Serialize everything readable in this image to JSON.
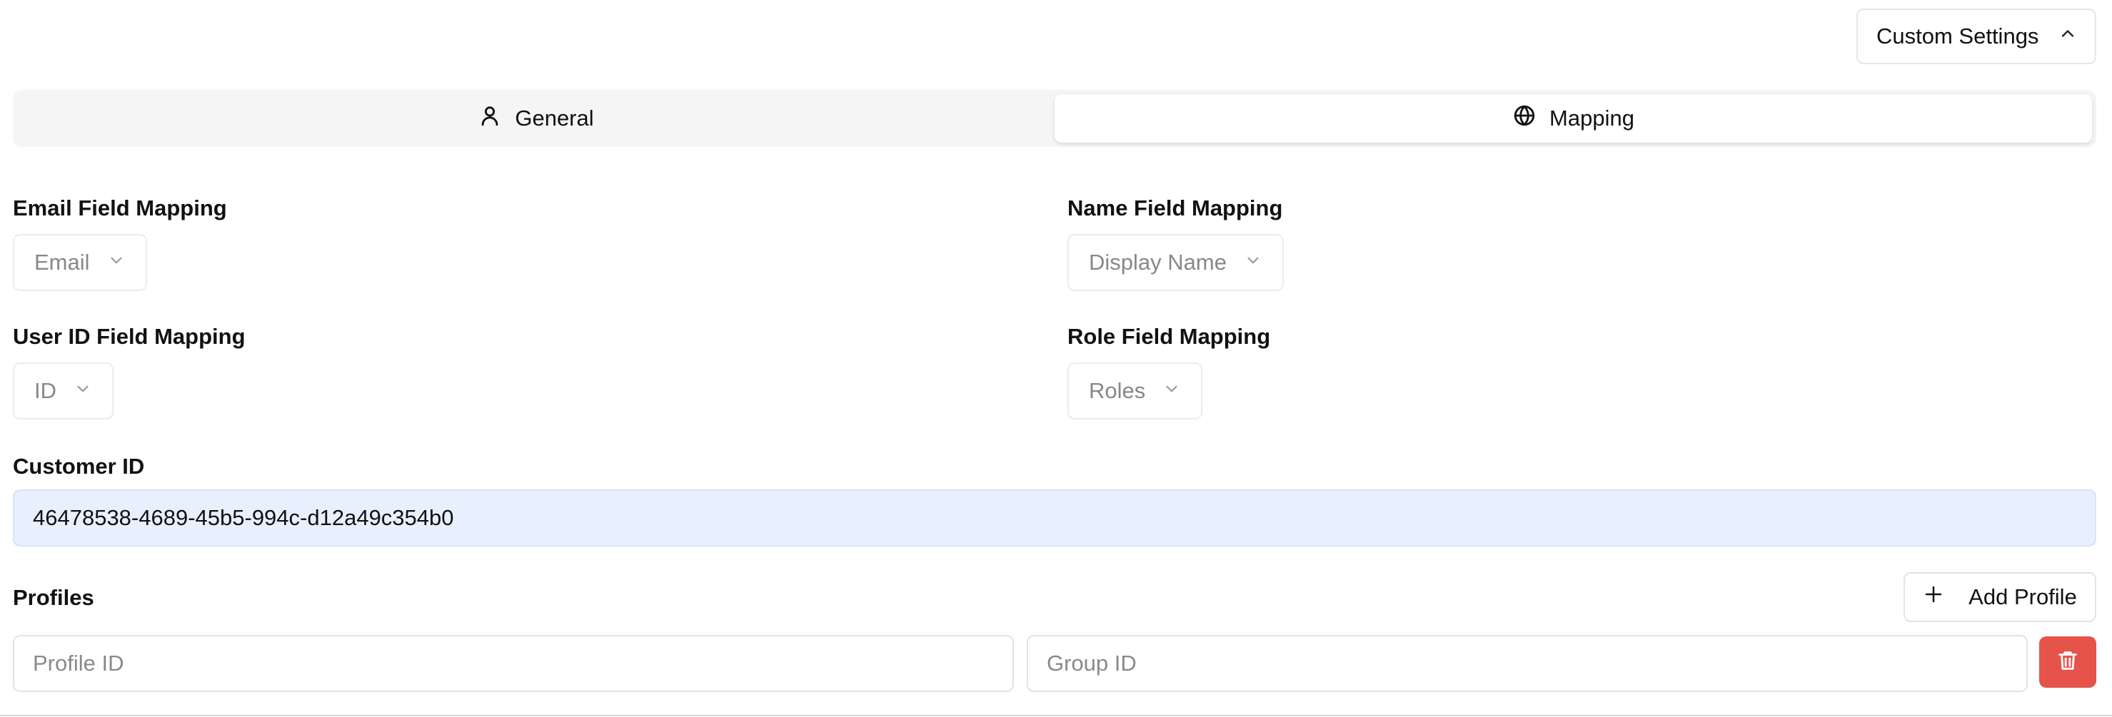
{
  "header": {
    "custom_settings_label": "Custom Settings"
  },
  "tabs": [
    {
      "label": "General",
      "icon": "user-icon",
      "active": false
    },
    {
      "label": "Mapping",
      "icon": "globe-icon",
      "active": true
    }
  ],
  "mapping": {
    "email": {
      "label": "Email Field Mapping",
      "value": "Email"
    },
    "name": {
      "label": "Name Field Mapping",
      "value": "Display Name"
    },
    "user_id": {
      "label": "User ID Field Mapping",
      "value": "ID"
    },
    "role": {
      "label": "Role Field Mapping",
      "value": "Roles"
    }
  },
  "customer": {
    "label": "Customer ID",
    "value": "46478538-4689-45b5-994c-d12a49c354b0"
  },
  "profiles": {
    "label": "Profiles",
    "add_label": "Add Profile",
    "profile_id_placeholder": "Profile ID",
    "group_id_placeholder": "Group ID"
  },
  "colors": {
    "accent_danger": "#e5534b",
    "customer_id_bg": "#e8f0fd"
  }
}
